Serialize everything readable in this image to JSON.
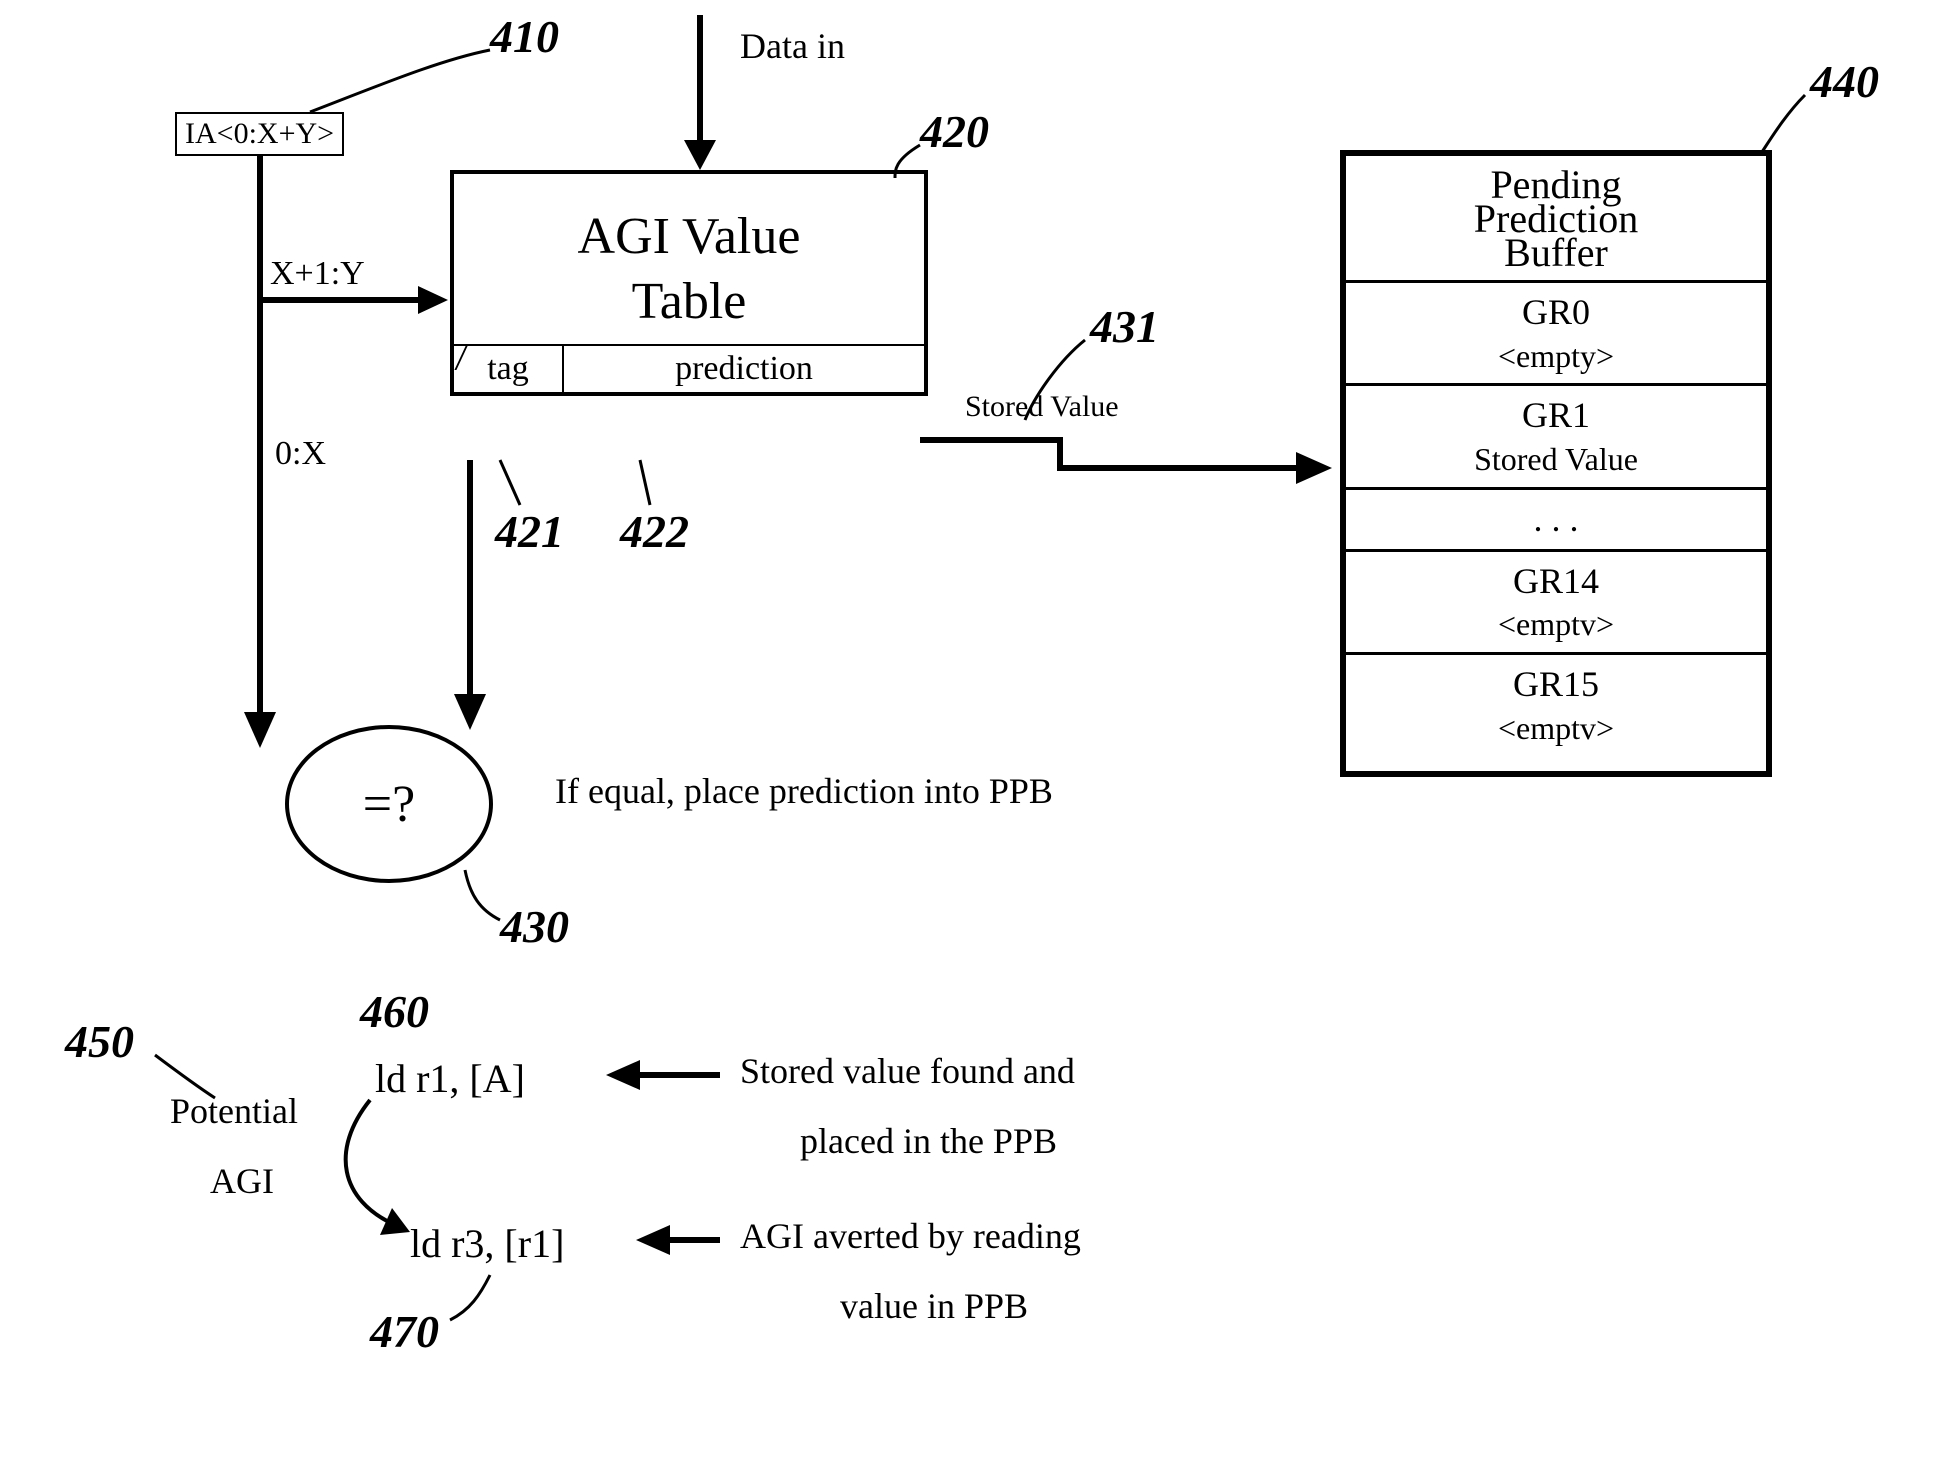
{
  "data_in_label": "Data in",
  "ia_box": "IA<0:X+Y>",
  "ia_branch_top": "X+1:Y",
  "ia_branch_bot": "0:X",
  "agi": {
    "title_line1": "AGI Value",
    "title_line2": "Table",
    "tag_label": "tag",
    "pred_label": "prediction"
  },
  "stored_value_label": "Stored Value",
  "comparator_label": "=?",
  "comparator_note": "If equal, place prediction into PPB",
  "ppb": {
    "title_line1": "Pending",
    "title_line2": "Prediction",
    "title_line3": "Buffer",
    "rows": [
      {
        "reg": "GR0",
        "val": "<empty>"
      },
      {
        "reg": "GR1",
        "val": "Stored Value"
      },
      {
        "reg": ". . .",
        "val": ""
      },
      {
        "reg": "GR14",
        "val": "<emptv>"
      },
      {
        "reg": "GR15",
        "val": "<emptv>"
      }
    ]
  },
  "example": {
    "potential_agi_line1": "Potential",
    "potential_agi_line2": "AGI",
    "instr1": "ld r1, [A]",
    "instr2": "ld r3, [r1]",
    "note1_line1": "Stored value found and",
    "note1_line2": "placed in the PPB",
    "note2_line1": "AGI averted by reading",
    "note2_line2": "value in PPB"
  },
  "refs": {
    "r410": "410",
    "r420": "420",
    "r421": "421",
    "r422": "422",
    "r430": "430",
    "r431": "431",
    "r440": "440",
    "r450": "450",
    "r460": "460",
    "r470": "470"
  }
}
